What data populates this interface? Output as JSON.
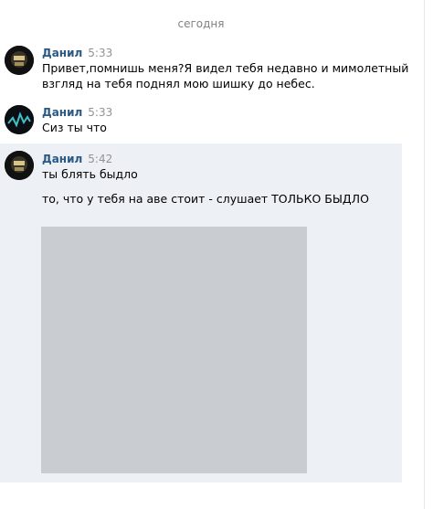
{
  "chat": {
    "date_divider": "сегодня",
    "messages": [
      {
        "author": "Данил",
        "time": "5:33",
        "lines": [
          "Привет,помнишь меня?Я видел тебя недавно и мимолетный",
          "взгляд на тебя поднял мою шишку до небес."
        ]
      },
      {
        "author": "Данил",
        "time": "5:33",
        "lines": [
          "Сиз ты что"
        ]
      },
      {
        "author": "Данил",
        "time": "5:42",
        "lines": [
          "ты блять быдло",
          "то, что у тебя на аве стоит - слушает ТОЛЬКО БЫДЛО"
        ],
        "attachment": "photo"
      }
    ]
  },
  "colors": {
    "author": "#2a5885",
    "time": "#939393",
    "highlight": "#edf0f5",
    "divider_text": "#828282"
  }
}
